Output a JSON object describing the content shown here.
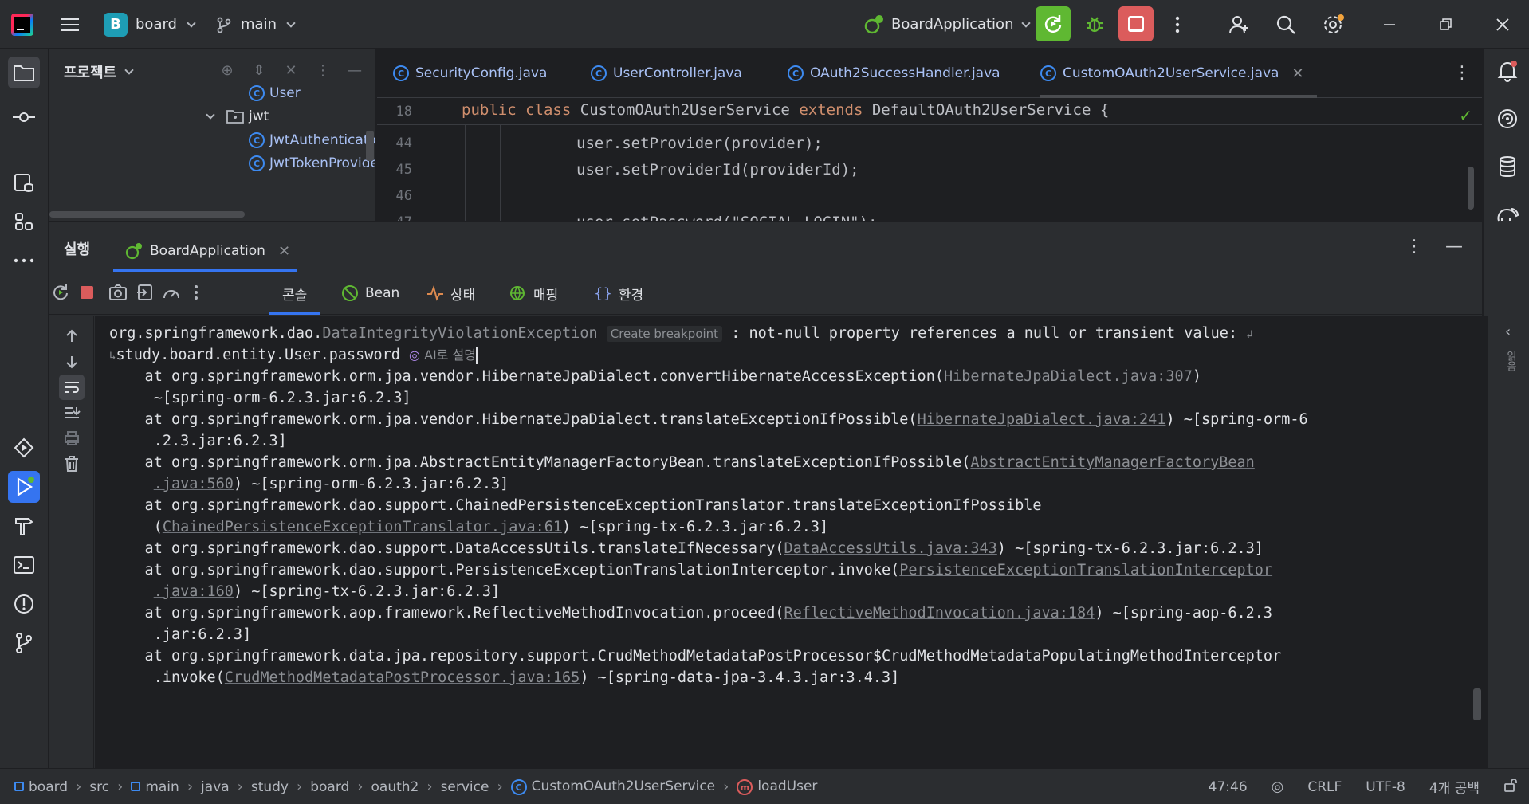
{
  "titlebar": {
    "project_badge": "B",
    "project_name": "board",
    "branch": "main",
    "run_config": "BoardApplication"
  },
  "project_panel": {
    "title": "프로젝트",
    "tree": [
      {
        "label": "User",
        "kind": "class"
      },
      {
        "label": "jwt",
        "kind": "package"
      },
      {
        "label": "JwtAuthenticatio",
        "kind": "class"
      },
      {
        "label": "JwtTokenProvide",
        "kind": "class"
      }
    ]
  },
  "editor": {
    "tabs": [
      {
        "label": "SecurityConfig.java"
      },
      {
        "label": "UserController.java"
      },
      {
        "label": "OAuth2SuccessHandler.java"
      },
      {
        "label": "CustomOAuth2UserService.java",
        "active": true
      }
    ],
    "sticky_line": {
      "number": "18",
      "kw1": "public",
      "kw2": "class",
      "name": "CustomOAuth2UserService",
      "kw3": "extends",
      "rest": "DefaultOAuth2UserService {"
    },
    "lines": [
      {
        "number": "44",
        "text": "user.setProvider(provider);"
      },
      {
        "number": "45",
        "text": "user.setProviderId(providerId);"
      },
      {
        "number": "46",
        "text": ""
      },
      {
        "number": "47",
        "text": "user.setPassword(\"SOCIAL_LOGIN\");"
      }
    ]
  },
  "run_panel": {
    "title": "실행",
    "tab_label": "BoardApplication",
    "subtabs": [
      "콘솔",
      "Bean",
      "상태",
      "매핑",
      "환경"
    ],
    "side_label": "읽음"
  },
  "console": {
    "line1_prefix": "org.springframework.dao.",
    "line1_link": "DataIntegrityViolationException",
    "line1_hint": "Create breakpoint",
    "line1_suffix": ": not-null property references a null or transient value:",
    "line2_text": "study.board.entity.User.password",
    "line2_ai": "AI로 설명",
    "frames": [
      {
        "l1_pre": "    at org.springframework.orm.jpa.vendor.HibernateJpaDialect.convertHibernateAccessException(",
        "l1_link": "HibernateJpaDialect.java:307",
        "l1_post": ")",
        "l2_pre": "     ~[spring-orm-6.2.3.jar:6.2.3]",
        "l2_link": "",
        "l2_post": ""
      },
      {
        "l1_pre": "    at org.springframework.orm.jpa.vendor.HibernateJpaDialect.translateExceptionIfPossible(",
        "l1_link": "HibernateJpaDialect.java:241",
        "l1_post": ") ~[spring-orm-6",
        "l2_pre": "     .2.3.jar:6.2.3]",
        "l2_link": "",
        "l2_post": ""
      },
      {
        "l1_pre": "    at org.springframework.orm.jpa.AbstractEntityManagerFactoryBean.translateExceptionIfPossible(",
        "l1_link": "AbstractEntityManagerFactoryBean",
        "l1_post": "",
        "l2_pre": "     ",
        "l2_link": ".java:560",
        "l2_post": ") ~[spring-orm-6.2.3.jar:6.2.3]"
      },
      {
        "l1_pre": "    at org.springframework.dao.support.ChainedPersistenceExceptionTranslator.translateExceptionIfPossible",
        "l1_link": "",
        "l1_post": "",
        "l2_pre": "     (",
        "l2_link": "ChainedPersistenceExceptionTranslator.java:61",
        "l2_post": ") ~[spring-tx-6.2.3.jar:6.2.3]"
      },
      {
        "l1_pre": "    at org.springframework.dao.support.DataAccessUtils.translateIfNecessary(",
        "l1_link": "DataAccessUtils.java:343",
        "l1_post": ") ~[spring-tx-6.2.3.jar:6.2.3]",
        "l2_pre": "",
        "l2_link": "",
        "l2_post": "",
        "single": true
      },
      {
        "l1_pre": "    at org.springframework.dao.support.PersistenceExceptionTranslationInterceptor.invoke(",
        "l1_link": "PersistenceExceptionTranslationInterceptor",
        "l1_post": "",
        "l2_pre": "     ",
        "l2_link": ".java:160",
        "l2_post": ") ~[spring-tx-6.2.3.jar:6.2.3]"
      },
      {
        "l1_pre": "    at org.springframework.aop.framework.ReflectiveMethodInvocation.proceed(",
        "l1_link": "ReflectiveMethodInvocation.java:184",
        "l1_post": ") ~[spring-aop-6.2.3",
        "l2_pre": "     .jar:6.2.3]",
        "l2_link": "",
        "l2_post": ""
      },
      {
        "l1_pre": "    at org.springframework.data.jpa.repository.support.CrudMethodMetadataPostProcessor$CrudMethodMetadataPopulatingMethodInterceptor",
        "l1_link": "",
        "l1_post": "",
        "l2_pre": "     .invoke(",
        "l2_link": "CrudMethodMetadataPostProcessor.java:165",
        "l2_post": ") ~[spring-data-jpa-3.4.3.jar:3.4.3]"
      }
    ]
  },
  "statusbar": {
    "crumbs": [
      "board",
      "src",
      "main",
      "java",
      "study",
      "board",
      "oauth2",
      "service",
      "CustomOAuth2UserService",
      "loadUser"
    ],
    "position": "47:46",
    "line_ending": "CRLF",
    "encoding": "UTF-8",
    "indent": "4개 공백"
  },
  "colors": {
    "accent": "#3574f0",
    "run_green": "#5fb832",
    "stop_red": "#db5c5c",
    "keyword": "#cf8e6d"
  }
}
